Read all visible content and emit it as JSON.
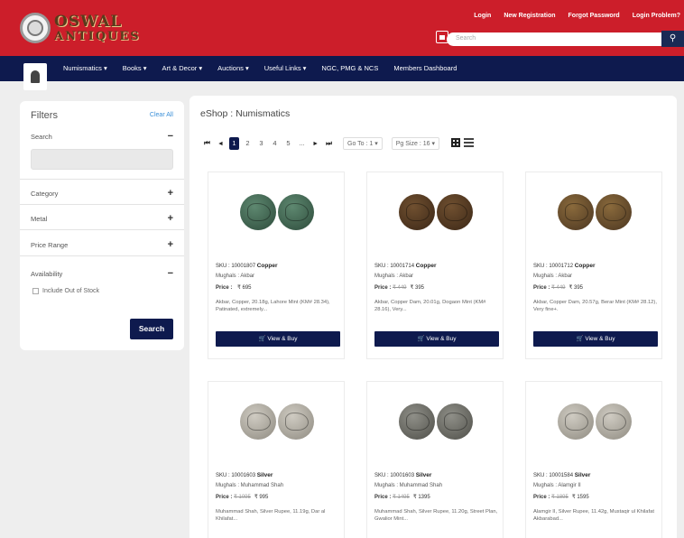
{
  "header": {
    "logo_line1": "OSWAL",
    "logo_line2": "ANTIQUES",
    "links": [
      "Login",
      "New Registration",
      "Forgot Password",
      "Login Problem?"
    ],
    "search_placeholder": "Search"
  },
  "nav": {
    "items": [
      "Numismatics ▾",
      "Books ▾",
      "Art & Decor ▾",
      "Auctions ▾",
      "Useful Links ▾",
      "NGC, PMG & NCS",
      "Members Dashboard"
    ]
  },
  "filters": {
    "title": "Filters",
    "clear": "Clear All",
    "search_label": "Search",
    "category_label": "Category",
    "metal_label": "Metal",
    "price_label": "Price Range",
    "availability_label": "Availability",
    "include_label": "Include Out of Stock",
    "search_button": "Search",
    "minus": "−",
    "plus": "+"
  },
  "main": {
    "breadcrumb": "eShop : Numismatics",
    "pager": {
      "first": "⏮",
      "prev": "◂",
      "pages": [
        "1",
        "2",
        "3",
        "4",
        "5",
        "..."
      ],
      "next": "▸",
      "last": "⏭",
      "goto": "Go To : 1 ▾",
      "pgsize_label": "Pg Size : 16 ▾"
    }
  },
  "products": [
    {
      "sku": "SKU : 10001807",
      "metal": "Copper",
      "category": "Mughals : Akbar",
      "price_label": "Price :",
      "old_price": "",
      "price": "₹ 695",
      "desc": "Akbar, Copper, 20.18g, Lahore Mint (KM# 28.34), Patinated, extremely...",
      "button": "🛒 View & Buy",
      "coin_style": "teal"
    },
    {
      "sku": "SKU : 10001714",
      "metal": "Copper",
      "category": "Mughals : Akbar",
      "price_label": "Price :",
      "old_price": "₹ 449",
      "price": "₹ 395",
      "desc": "Akbar, Copper Dam, 20.01g, Dogaon Mint (KM# 28.16), Very...",
      "button": "🛒 View & Buy",
      "coin_style": "dark"
    },
    {
      "sku": "SKU : 10001712",
      "metal": "Copper",
      "category": "Mughals : Akbar",
      "price_label": "Price :",
      "old_price": "₹ 449",
      "price": "₹ 395",
      "desc": "Akbar, Copper Dam, 20.57g, Berar Mint (KM# 28.12), Very fine+.",
      "button": "🛒 View & Buy",
      "coin_style": "copper"
    },
    {
      "sku": "SKU : 10001603",
      "metal": "Silver",
      "category": "Mughals : Muhammad Shah",
      "price_label": "Price :",
      "old_price": "₹ 1095",
      "price": "₹ 995",
      "desc": "Muhammad Shah, Silver Rupee, 11.19g, Dar al Khilafat...",
      "button": "🛒 View & Buy",
      "coin_style": "silver"
    },
    {
      "sku": "SKU : 10001603",
      "metal": "Silver",
      "category": "Mughals : Muhammad Shah",
      "price_label": "Price :",
      "old_price": "₹ 1495",
      "price": "₹ 1395",
      "desc": "Muhammad Shah, Silver Rupee, 11.20g, Street Plan, Gwalior Mint...",
      "button": "🛒 View & Buy",
      "coin_style": "darksilver"
    },
    {
      "sku": "SKU : 10001584",
      "metal": "Silver",
      "category": "Mughals : Alamgir II",
      "price_label": "Price :",
      "old_price": "₹ 1895",
      "price": "₹ 1595",
      "desc": "Alamgir II, Silver Rupee, 11.42g, Mustaqir ul Khilafat Akbarabad...",
      "button": "🛒 View & Buy",
      "coin_style": "silver"
    }
  ]
}
